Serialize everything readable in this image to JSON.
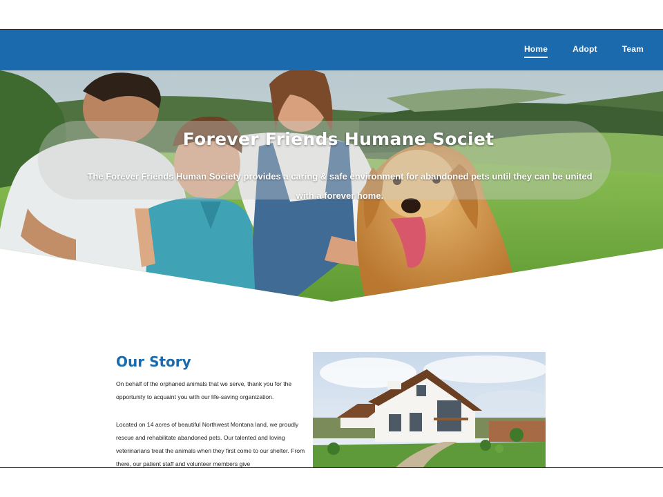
{
  "nav": {
    "items": [
      {
        "label": "Home",
        "active": true
      },
      {
        "label": "Adopt",
        "active": false
      },
      {
        "label": "Team",
        "active": false
      }
    ]
  },
  "hero": {
    "title": "Forever Friends Humane Societ",
    "subtitle": "The Forever Friends Human Society provides a caring & safe environment for abandoned pets until they can be united with a forever home."
  },
  "story": {
    "title": "Our Story",
    "paragraphs": [
      "On behalf of the orphaned animals that we serve, thank you for the opportunity to acquaint you with our life-saving organization.",
      "Located on 14 acres of beautiful Northwest Montana land, we proudly rescue and rehabilitate abandoned pets. Our talented and loving veterinarians treat the animals when they first come to our shelter. From there, our patient staff and volunteer members give"
    ]
  },
  "colors": {
    "brand_blue": "#1a6aad",
    "text_dark": "#222222"
  },
  "images": {
    "hero": "family-with-golden-retriever-in-meadow",
    "story": "country-house-with-garden"
  }
}
